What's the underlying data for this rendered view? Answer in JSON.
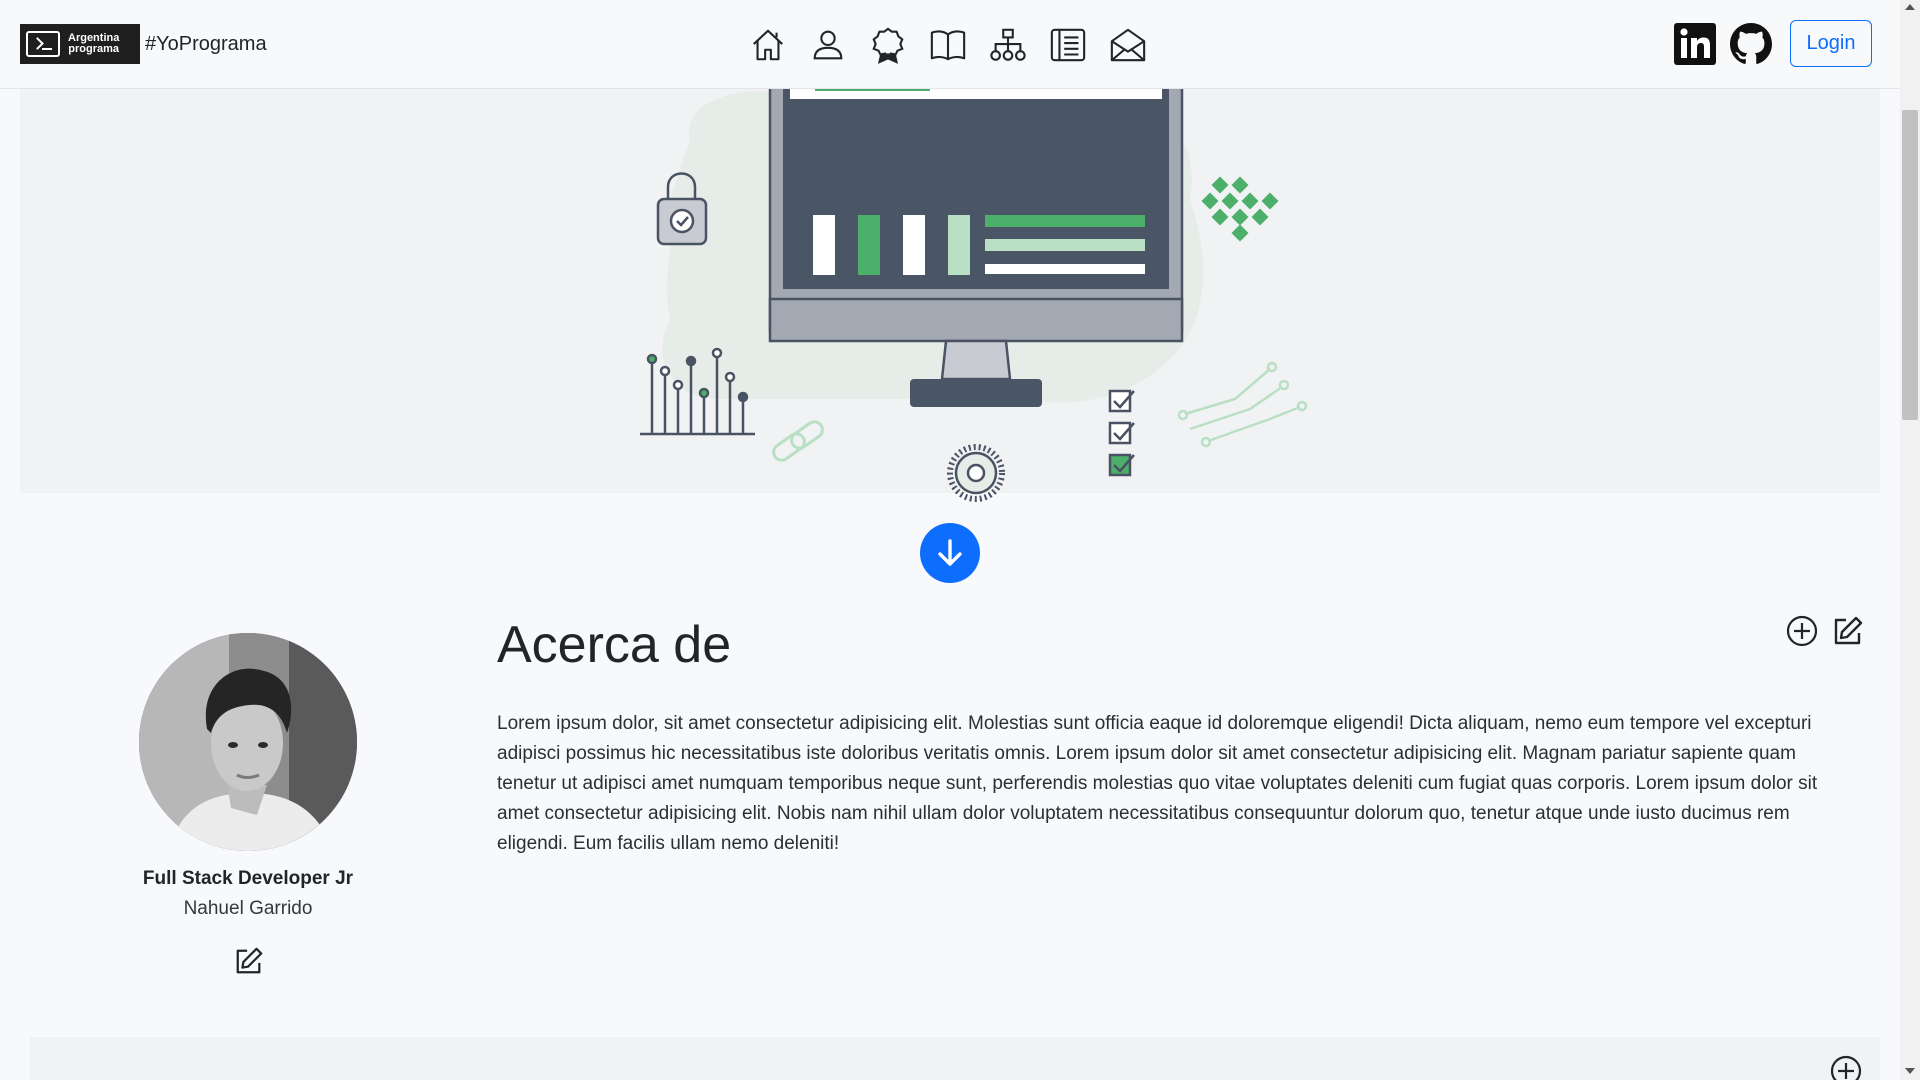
{
  "navbar": {
    "logo_line1": "Argentina",
    "logo_line2": "programa",
    "brand_tag": "#YoPrograma",
    "icons": [
      "home-icon",
      "person-icon",
      "award-icon",
      "book-icon",
      "diagram-icon",
      "journal-icon",
      "envelope-icon"
    ],
    "social": [
      "linkedin-icon",
      "github-icon"
    ],
    "login_label": "Login"
  },
  "about": {
    "title": "Acerca de",
    "text": "Lorem ipsum dolor, sit amet consectetur adipisicing elit. Molestias sunt officia eaque id doloremque eligendi! Dicta aliquam, nemo eum tempore vel excepturi adipisci possimus hic necessitatibus iste doloribus veritatis omnis. Lorem ipsum dolor sit amet consectetur adipisicing elit. Magnam pariatur sapiente quam tenetur ut adipisci amet numquam temporibus neque sunt, perferendis molestias quo vitae voluptates deleniti cum fugiat quas corporis. Lorem ipsum dolor sit amet consectetur adipisicing elit. Nobis nam nihil ullam dolor voluptatem necessitatibus consequuntur dolorum quo, tenetur atque unde iusto ducimus rem eligendi. Eum facilis ullam nemo deleniti!"
  },
  "profile": {
    "role": "Full Stack Developer Jr",
    "name": "Nahuel Garrido"
  },
  "colors": {
    "primary": "#0d6efd",
    "accent_green": "#4caf6a",
    "dark": "#212529"
  }
}
